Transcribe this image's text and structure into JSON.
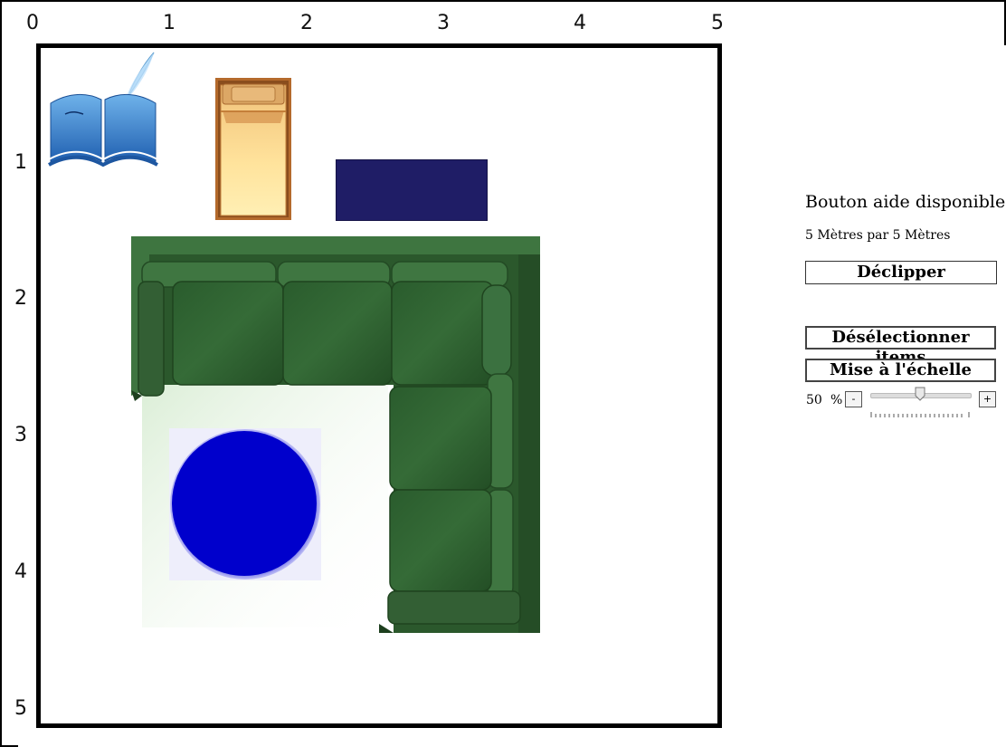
{
  "axes": {
    "x_labels": [
      "0",
      "1",
      "2",
      "3",
      "4",
      "5"
    ],
    "y_labels": [
      "1",
      "2",
      "3",
      "4",
      "5"
    ]
  },
  "room": {
    "help_text": "Bouton aide disponible!",
    "dimensions_text": "5 Mètres par 5 Mètres"
  },
  "buttons": {
    "declipper": "Déclipper",
    "deselect": "Désélectionner items",
    "scale": "Mise à l'échelle"
  },
  "zoom": {
    "value": "50",
    "unit": "%",
    "minus": "-",
    "plus": "+",
    "level_percent": 50
  },
  "items": {
    "book_icon": "book-quill-icon",
    "bed": "single-bed",
    "rug_color": "#1f1d66",
    "sofa": "corner-sofa",
    "sofa_color": "#2f5e2f",
    "table": "round-table",
    "table_color": "#0000cc"
  }
}
